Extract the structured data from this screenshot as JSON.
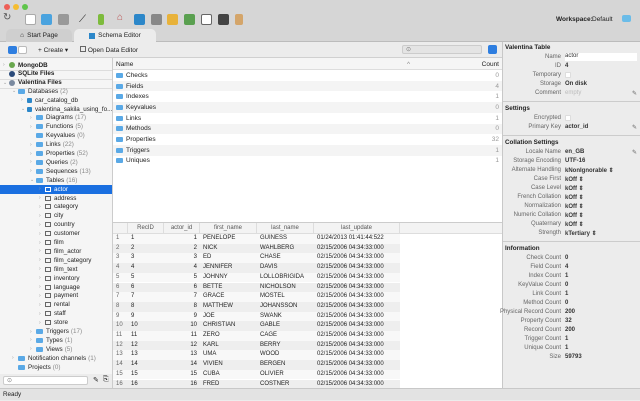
{
  "window": {
    "workspace_label": "Workspace:",
    "workspace_value": "Default"
  },
  "tabs": [
    {
      "label": "Start Page",
      "active": false
    },
    {
      "label": "Schema Editor",
      "active": true
    }
  ],
  "subtoolbar": {
    "create_label": "Create",
    "open_data_editor_label": "Open Data Editor"
  },
  "tree": [
    {
      "label": "MongoDB",
      "level": 0,
      "bold": true,
      "chev": ">",
      "icon": "mongodb-icon"
    },
    {
      "label": "SQLite Files",
      "level": 0,
      "bold": true,
      "chev": "",
      "icon": "sqlite-icon"
    },
    {
      "label": "Valentina Files",
      "level": 0,
      "bold": true,
      "chev": "v",
      "icon": "valentina-icon"
    },
    {
      "label": "Databases",
      "count": "(2)",
      "level": 1,
      "chev": "v",
      "icon": "folder"
    },
    {
      "label": "car_catalog_db",
      "level": 2,
      "chev": ">",
      "icon": "database"
    },
    {
      "label": "valentina_sakila_using_fo...",
      "level": 2,
      "chev": "v",
      "icon": "database"
    },
    {
      "label": "Diagrams",
      "count": "(17)",
      "level": 3,
      "chev": ">",
      "icon": "folder"
    },
    {
      "label": "Functions",
      "count": "(5)",
      "level": 3,
      "chev": ">",
      "icon": "folder"
    },
    {
      "label": "Keyvalues",
      "count": "(0)",
      "level": 3,
      "chev": "",
      "icon": "folder"
    },
    {
      "label": "Links",
      "count": "(22)",
      "level": 3,
      "chev": ">",
      "icon": "folder"
    },
    {
      "label": "Properties",
      "count": "(52)",
      "level": 3,
      "chev": ">",
      "icon": "folder"
    },
    {
      "label": "Queries",
      "count": "(2)",
      "level": 3,
      "chev": ">",
      "icon": "folder"
    },
    {
      "label": "Sequences",
      "count": "(13)",
      "level": 3,
      "chev": ">",
      "icon": "folder"
    },
    {
      "label": "Tables",
      "count": "(16)",
      "level": 3,
      "chev": "v",
      "icon": "folder"
    },
    {
      "label": "actor",
      "level": 4,
      "chev": ">",
      "icon": "table",
      "selected": true
    },
    {
      "label": "address",
      "level": 4,
      "chev": ">",
      "icon": "table"
    },
    {
      "label": "category",
      "level": 4,
      "chev": ">",
      "icon": "table"
    },
    {
      "label": "city",
      "level": 4,
      "chev": ">",
      "icon": "table"
    },
    {
      "label": "country",
      "level": 4,
      "chev": ">",
      "icon": "table"
    },
    {
      "label": "customer",
      "level": 4,
      "chev": ">",
      "icon": "table"
    },
    {
      "label": "film",
      "level": 4,
      "chev": ">",
      "icon": "table"
    },
    {
      "label": "film_actor",
      "level": 4,
      "chev": ">",
      "icon": "table"
    },
    {
      "label": "film_category",
      "level": 4,
      "chev": ">",
      "icon": "table"
    },
    {
      "label": "film_text",
      "level": 4,
      "chev": ">",
      "icon": "table"
    },
    {
      "label": "inventory",
      "level": 4,
      "chev": ">",
      "icon": "table"
    },
    {
      "label": "language",
      "level": 4,
      "chev": ">",
      "icon": "table"
    },
    {
      "label": "payment",
      "level": 4,
      "chev": ">",
      "icon": "table"
    },
    {
      "label": "rental",
      "level": 4,
      "chev": ">",
      "icon": "table"
    },
    {
      "label": "staff",
      "level": 4,
      "chev": ">",
      "icon": "table"
    },
    {
      "label": "store",
      "level": 4,
      "chev": ">",
      "icon": "table"
    },
    {
      "label": "Triggers",
      "count": "(17)",
      "level": 3,
      "chev": ">",
      "icon": "folder"
    },
    {
      "label": "Types",
      "count": "(1)",
      "level": 3,
      "chev": ">",
      "icon": "folder"
    },
    {
      "label": "Views",
      "count": "(5)",
      "level": 3,
      "chev": ">",
      "icon": "folder"
    },
    {
      "label": "Notification channels",
      "count": "(1)",
      "level": 1,
      "chev": ">",
      "icon": "folder"
    },
    {
      "label": "Projects",
      "count": "(0)",
      "level": 1,
      "chev": "",
      "icon": "folder"
    }
  ],
  "list": {
    "col_name": "Name",
    "col_count": "Count",
    "items": [
      {
        "name": "Checks",
        "count": "0"
      },
      {
        "name": "Fields",
        "count": "4"
      },
      {
        "name": "Indexes",
        "count": "1"
      },
      {
        "name": "Keyvalues",
        "count": "0"
      },
      {
        "name": "Links",
        "count": "1"
      },
      {
        "name": "Methods",
        "count": "0"
      },
      {
        "name": "Properties",
        "count": "32"
      },
      {
        "name": "Triggers",
        "count": "1"
      },
      {
        "name": "Uniques",
        "count": "1"
      }
    ]
  },
  "grid": {
    "columns": [
      "",
      "RecID",
      "actor_id",
      "first_name",
      "last_name",
      "last_update"
    ],
    "rows": [
      [
        "1",
        "1",
        "1",
        "PENELOPE",
        "GUINESS",
        "01/24/2013 01:41:44:522"
      ],
      [
        "2",
        "2",
        "2",
        "NICK",
        "WAHLBERG",
        "02/15/2006 04:34:33:000"
      ],
      [
        "3",
        "3",
        "3",
        "ED",
        "CHASE",
        "02/15/2006 04:34:33:000"
      ],
      [
        "4",
        "4",
        "4",
        "JENNIFER",
        "DAVIS",
        "02/15/2006 04:34:33:000"
      ],
      [
        "5",
        "5",
        "5",
        "JOHNNY",
        "LOLLOBRIGIDA",
        "02/15/2006 04:34:33:000"
      ],
      [
        "6",
        "6",
        "6",
        "BETTE",
        "NICHOLSON",
        "02/15/2006 04:34:33:000"
      ],
      [
        "7",
        "7",
        "7",
        "GRACE",
        "MOSTEL",
        "02/15/2006 04:34:33:000"
      ],
      [
        "8",
        "8",
        "8",
        "MATTHEW",
        "JOHANSSON",
        "02/15/2006 04:34:33:000"
      ],
      [
        "9",
        "9",
        "9",
        "JOE",
        "SWANK",
        "02/15/2006 04:34:33:000"
      ],
      [
        "10",
        "10",
        "10",
        "CHRISTIAN",
        "GABLE",
        "02/15/2006 04:34:33:000"
      ],
      [
        "11",
        "11",
        "11",
        "ZERO",
        "CAGE",
        "02/15/2006 04:34:33:000"
      ],
      [
        "12",
        "12",
        "12",
        "KARL",
        "BERRY",
        "02/15/2006 04:34:33:000"
      ],
      [
        "13",
        "13",
        "13",
        "UMA",
        "WOOD",
        "02/15/2006 04:34:33:000"
      ],
      [
        "14",
        "14",
        "14",
        "VIVIEN",
        "BERGEN",
        "02/15/2006 04:34:33:000"
      ],
      [
        "15",
        "15",
        "15",
        "CUBA",
        "OLIVIER",
        "02/15/2006 04:34:33:000"
      ],
      [
        "16",
        "16",
        "16",
        "FRED",
        "COSTNER",
        "02/15/2006 04:34:33:000"
      ]
    ]
  },
  "inspector": {
    "sections": [
      {
        "title": "Valentina Table",
        "props": [
          [
            "Name",
            "actor"
          ],
          [
            "ID",
            "4"
          ],
          [
            "Temporary",
            ""
          ],
          [
            "Storage",
            "On disk"
          ],
          [
            "Comment",
            "empty"
          ]
        ]
      },
      {
        "title": "Settings",
        "props": [
          [
            "Encrypted",
            ""
          ],
          [
            "Primary Key",
            "actor_id"
          ]
        ]
      },
      {
        "title": "Collation Settings",
        "props": [
          [
            "Locale Name",
            "en_GB"
          ],
          [
            "Storage Encoding",
            "UTF-16"
          ],
          [
            "Alternate Handling",
            "kNonIgnorable ⇕"
          ],
          [
            "Case First",
            "kOff ⇕"
          ],
          [
            "Case Level",
            "kOff ⇕"
          ],
          [
            "French Collation",
            "kOff ⇕"
          ],
          [
            "Normalization",
            "kOff ⇕"
          ],
          [
            "Numeric Collation",
            "kOff ⇕"
          ],
          [
            "Quaternary",
            "kOff ⇕"
          ],
          [
            "Strength",
            "kTertiary ⇕"
          ]
        ]
      },
      {
        "title": "Information",
        "props": [
          [
            "Check Count",
            "0"
          ],
          [
            "Field Count",
            "4"
          ],
          [
            "Index Count",
            "1"
          ],
          [
            "KeyValue Count",
            "0"
          ],
          [
            "Link Count",
            "1"
          ],
          [
            "Method Count",
            "0"
          ],
          [
            "Physical Record Count",
            "200"
          ],
          [
            "Property Count",
            "32"
          ],
          [
            "Record Count",
            "200"
          ],
          [
            "Trigger Count",
            "1"
          ],
          [
            "Unique Count",
            "1"
          ],
          [
            "Size",
            "59793"
          ]
        ]
      }
    ]
  },
  "status": "Ready"
}
